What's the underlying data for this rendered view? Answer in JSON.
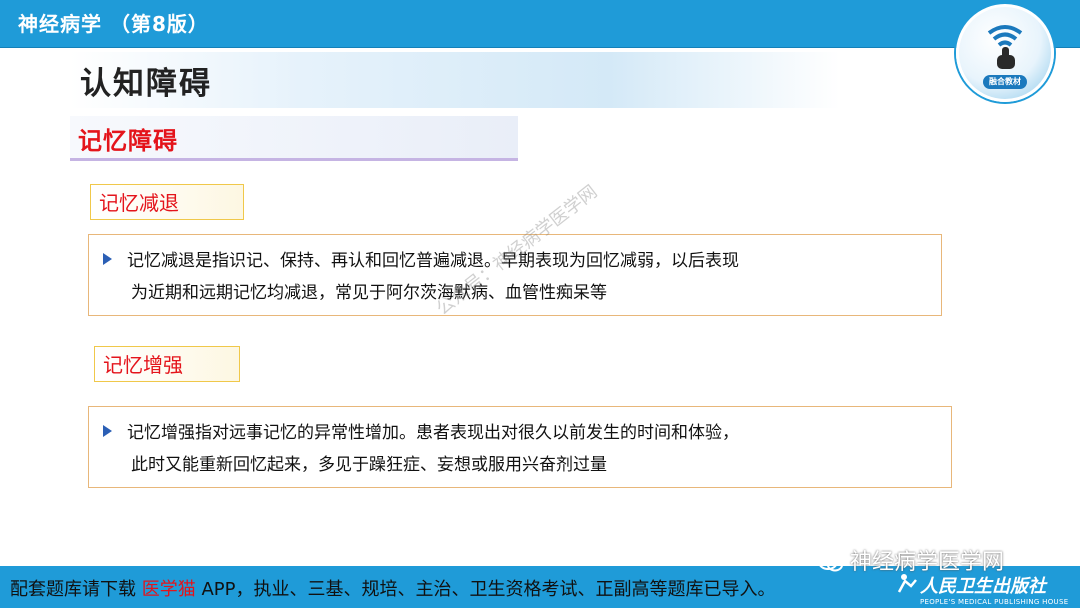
{
  "header": {
    "book_title": "神经病学 （第8版）",
    "logo_caption": "融合教材"
  },
  "slide": {
    "title": "认知障碍",
    "subtitle": "记忆障碍",
    "sections": [
      {
        "tag": "记忆减退",
        "lines": [
          "记忆减退是指识记、保持、再认和回忆普遍减退。早期表现为回忆减弱，以后表现",
          "为近期和远期记忆均减退，常见于阿尔茨海默病、血管性痴呆等"
        ]
      },
      {
        "tag": "记忆增强",
        "lines": [
          "记忆增强指对远事记忆的异常性增加。患者表现出对很久以前发生的时间和体验，",
          "此时又能重新回忆起来，多见于躁狂症、妄想或服用兴奋剂过量"
        ]
      }
    ],
    "watermark": "公众号：神经病学医学网"
  },
  "footer": {
    "text_before": "配套题库请下载 ",
    "highlight": "医学猫",
    "text_after": " APP，执业、三基、规培、主治、卫生资格考试、正副高等题库已导入。",
    "wechat_name": "神经病学医学网",
    "publisher_cn": "人民卫生出版社",
    "publisher_en": "PEOPLE'S MEDICAL PUBLISHING HOUSE"
  },
  "colors": {
    "blue_bar": "#1f9bd8",
    "red_text": "#e4141b",
    "box_border": "#e8b77a"
  }
}
